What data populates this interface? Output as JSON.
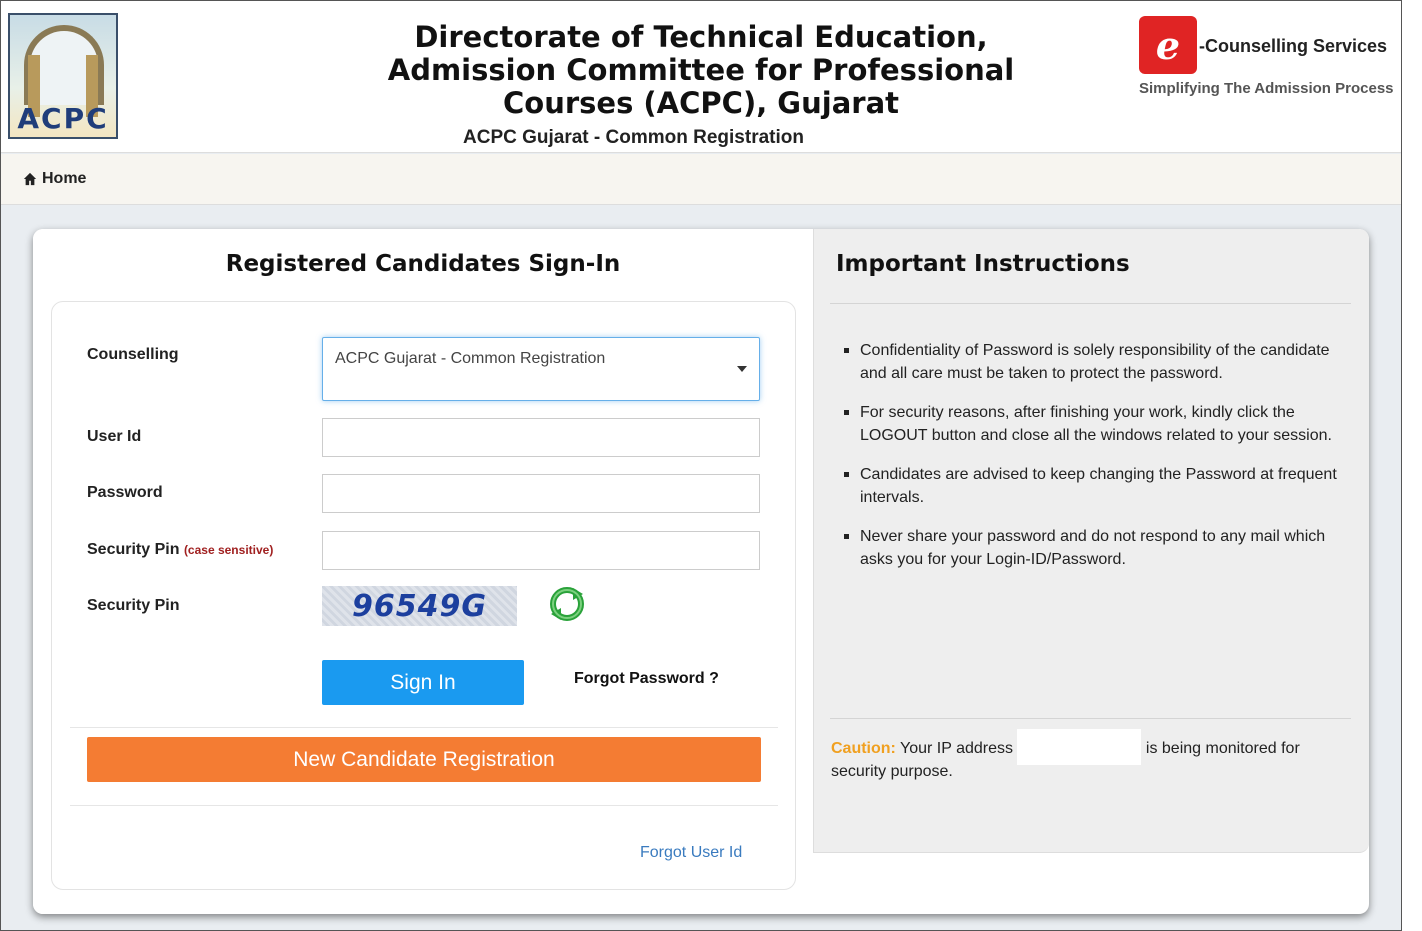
{
  "header": {
    "logo_text": "ACPC",
    "title_line1": "Directorate of Technical Education,",
    "title_line2": "Admission Committee for Professional",
    "title_line3": "Courses (ACPC), Gujarat",
    "subtitle": "ACPC Gujarat - Common Registration",
    "brand_badge": "e",
    "brand_name": "-Counselling Services",
    "brand_tagline": "Simplifying The Admission Process"
  },
  "nav": {
    "home_label": "Home"
  },
  "signin": {
    "title": "Registered Candidates Sign-In",
    "counselling_label": "Counselling",
    "counselling_value": "ACPC Gujarat - Common Registration",
    "userid_label": "User Id",
    "userid_value": "",
    "password_label": "Password",
    "password_value": "",
    "pin_label": "Security Pin",
    "pin_hint": "(case sensitive)",
    "pin_value": "",
    "captcha_label": "Security Pin",
    "captcha_text": "96549G",
    "signin_button": "Sign In",
    "forgot_password": "Forgot Password ?",
    "register_button": "New Candidate Registration",
    "forgot_userid": "Forgot User Id"
  },
  "instructions": {
    "title": "Important Instructions",
    "items": [
      "Confidentiality of Password is solely responsibility of the candidate and all care must be taken to protect the password.",
      "For security reasons, after finishing your work, kindly click the LOGOUT button and close all the windows related to your session.",
      "Candidates are advised to keep changing the Password at frequent intervals.",
      "Never share your password and do not respond to any mail which asks you for your Login-ID/Password."
    ],
    "caution_label": "Caution:",
    "caution_text_before": "Your IP address",
    "caution_text_after": "is being monitored for security purpose."
  },
  "colors": {
    "signin_button": "#1a9af0",
    "register_button": "#f47c33",
    "caution_label": "#f0a020",
    "link": "#3a7bbf"
  },
  "icons": [
    "home-icon",
    "chevron-down-icon",
    "refresh-icon"
  ]
}
